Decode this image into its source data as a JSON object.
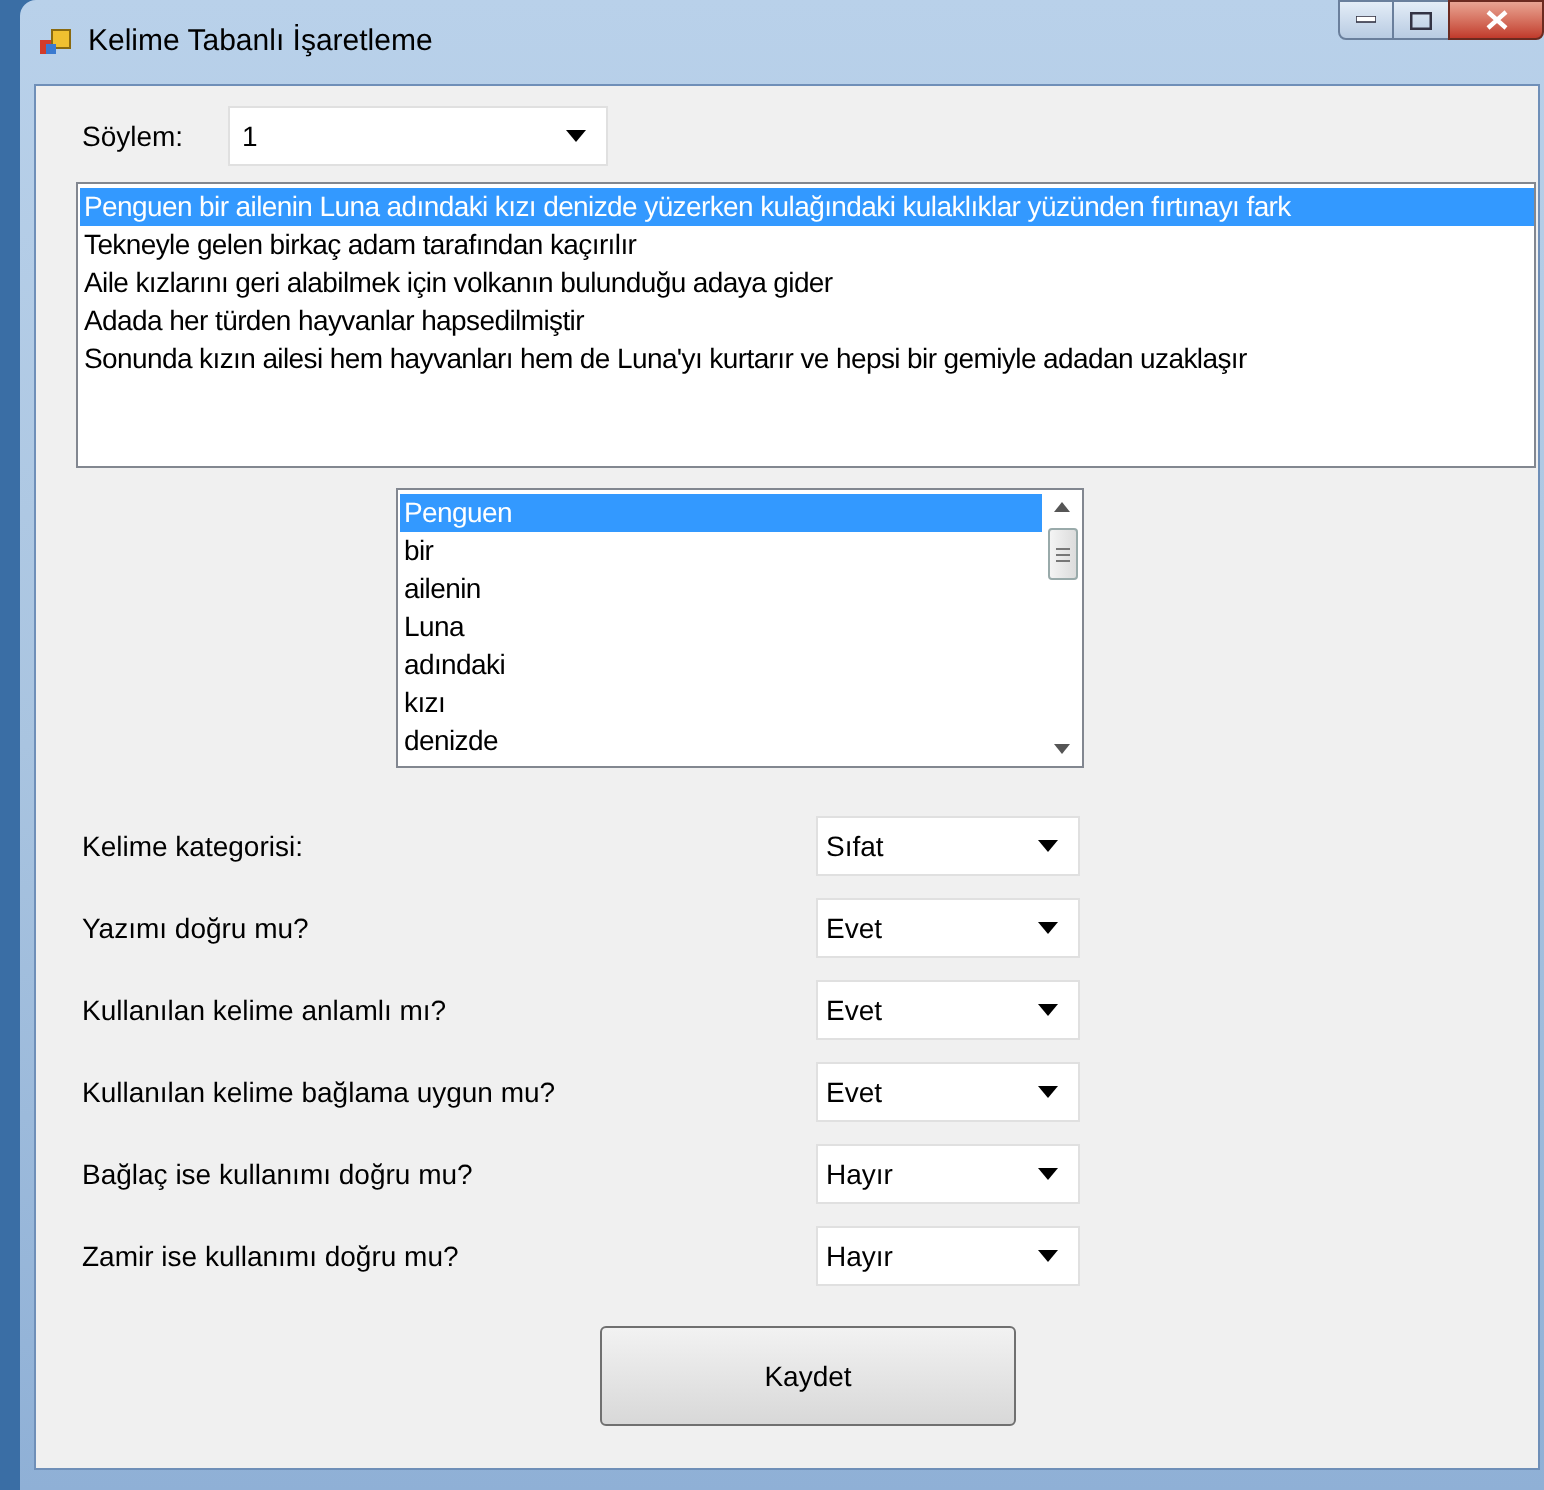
{
  "window": {
    "title": "Kelime Tabanlı İşaretleme"
  },
  "soylem": {
    "label": "Söylem:",
    "value": "1"
  },
  "sentences": [
    {
      "text": "Penguen bir ailenin Luna adındaki kızı denizde yüzerken kulağındaki kulaklıklar yüzünden fırtınayı fark",
      "selected": true
    },
    {
      "text": "Tekneyle gelen birkaç adam tarafından kaçırılır",
      "selected": false
    },
    {
      "text": "Aile kızlarını geri alabilmek için volkanın bulunduğu adaya gider",
      "selected": false
    },
    {
      "text": "Adada her türden hayvanlar hapsedilmiştir",
      "selected": false
    },
    {
      "text": "Sonunda kızın ailesi hem hayvanları hem de Luna'yı kurtarır ve hepsi bir gemiyle adadan uzaklaşır",
      "selected": false
    }
  ],
  "words": [
    {
      "text": "Penguen",
      "selected": true
    },
    {
      "text": "bir",
      "selected": false
    },
    {
      "text": "ailenin",
      "selected": false
    },
    {
      "text": "Luna",
      "selected": false
    },
    {
      "text": "adındaki",
      "selected": false
    },
    {
      "text": "kızı",
      "selected": false
    },
    {
      "text": "denizde",
      "selected": false
    }
  ],
  "questions": [
    {
      "label": "Kelime kategorisi:",
      "value": "Sıfat"
    },
    {
      "label": "Yazımı doğru mu?",
      "value": "Evet"
    },
    {
      "label": "Kullanılan kelime anlamlı mı?",
      "value": "Evet"
    },
    {
      "label": "Kullanılan kelime bağlama uygun mu?",
      "value": "Evet"
    },
    {
      "label": "Bağlaç ise kullanımı doğru mu?",
      "value": "Hayır"
    },
    {
      "label": "Zamir ise kullanımı doğru mu?",
      "value": "Hayır"
    }
  ],
  "save_button": "Kaydet"
}
